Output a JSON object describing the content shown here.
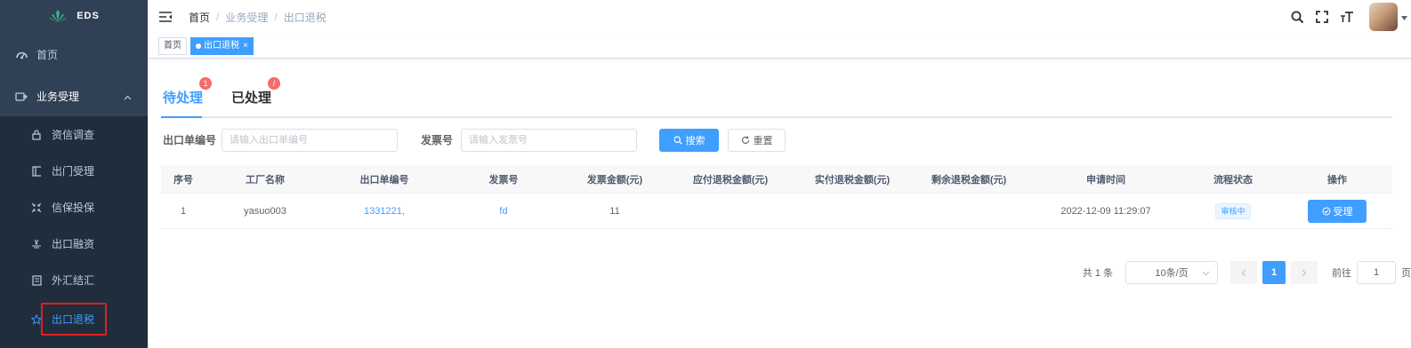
{
  "app": {
    "brand": "EDS"
  },
  "colors": {
    "sidebar_bg": "#304156",
    "submenu_bg": "#1f2d3d",
    "accent": "#409eff",
    "badge": "#f56c6c",
    "highlight_box": "#e02020"
  },
  "sidebar": {
    "home": {
      "label": "首页",
      "icon": "dashboard-icon"
    },
    "group": {
      "label": "业务受理",
      "icon": "business-icon",
      "expanded": true
    },
    "items": [
      {
        "label": "资信调查",
        "icon": "lock-icon"
      },
      {
        "label": "出门受理",
        "icon": "book-icon"
      },
      {
        "label": "信保投保",
        "icon": "shrink-icon"
      },
      {
        "label": "出口融资",
        "icon": "money-icon"
      },
      {
        "label": "外汇结汇",
        "icon": "exchange-icon"
      },
      {
        "label": "出口退税",
        "icon": "star-icon",
        "active": true
      }
    ]
  },
  "header": {
    "breadcrumb": [
      "首页",
      "业务受理",
      "出口退税"
    ],
    "tools": [
      "search-icon",
      "fullscreen-icon",
      "font-size-icon"
    ]
  },
  "tags": {
    "items": [
      {
        "label": "首页",
        "active": false
      },
      {
        "label": "出口退税",
        "active": true,
        "close": "×"
      }
    ]
  },
  "subtabs": [
    {
      "label": "待处理",
      "badge": "1",
      "active": true
    },
    {
      "label": "已处理",
      "badge": "/",
      "active": false
    }
  ],
  "search": {
    "order_no_label": "出口单编号",
    "order_no_placeholder": "请输入出口单编号",
    "invoice_label": "发票号",
    "invoice_placeholder": "请输入发票号",
    "search_button": "搜索",
    "reset_button": "重置"
  },
  "table": {
    "columns": [
      "序号",
      "工厂名称",
      "出口单编号",
      "发票号",
      "发票金额(元)",
      "应付退税金额(元)",
      "实付退税金额(元)",
      "剩余退税金额(元)",
      "申请时间",
      "流程状态",
      "操作"
    ],
    "rows": [
      {
        "index": "1",
        "factory": "yasuo003",
        "order_no": "1331221,",
        "invoice": "fd",
        "invoice_amount": "11",
        "payable": "",
        "paid": "",
        "remaining": "",
        "apply_time": "2022-12-09 11:29:07",
        "status": "审核中",
        "action": "受理"
      }
    ]
  },
  "pagination": {
    "total_text": "共 1 条",
    "page_size": "10条/页",
    "current_page": "1",
    "goto_label": "前往",
    "goto_value": "1",
    "page_unit": "页"
  }
}
